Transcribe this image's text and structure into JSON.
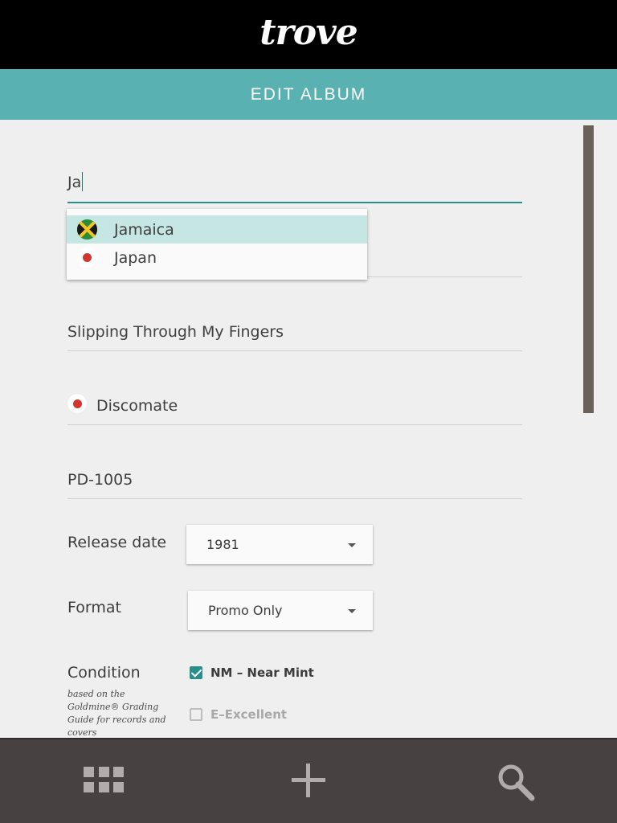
{
  "header": {
    "logo": "trove",
    "title": "EDIT ALBUM"
  },
  "form": {
    "country_input_value": "Ja",
    "country_suggestions": [
      {
        "label": "Jamaica",
        "flag": "jamaica-flag-icon",
        "highlighted": true
      },
      {
        "label": "Japan",
        "flag": "japan-flag-icon",
        "highlighted": false
      }
    ],
    "title_value": "Slipping Through My Fingers",
    "label_value": "Discomate",
    "catalog_value": "PD-1005",
    "release_date": {
      "label": "Release date",
      "value": "1981"
    },
    "format": {
      "label": "Format",
      "value": "Promo Only"
    },
    "condition": {
      "label": "Condition",
      "note": "based on the Goldmine® Grading Guide for records and covers",
      "options": [
        {
          "label": "NM – Near Mint",
          "checked": true
        },
        {
          "label": "E–Excellent",
          "checked": false
        }
      ]
    }
  },
  "bottom_nav": {
    "items": [
      "grid-icon",
      "add-icon",
      "search-icon"
    ]
  },
  "colors": {
    "accent": "#59b1b1",
    "check": "#2a8e8a",
    "bottom_bar": "#474142",
    "flag_red": "#d2352b"
  }
}
